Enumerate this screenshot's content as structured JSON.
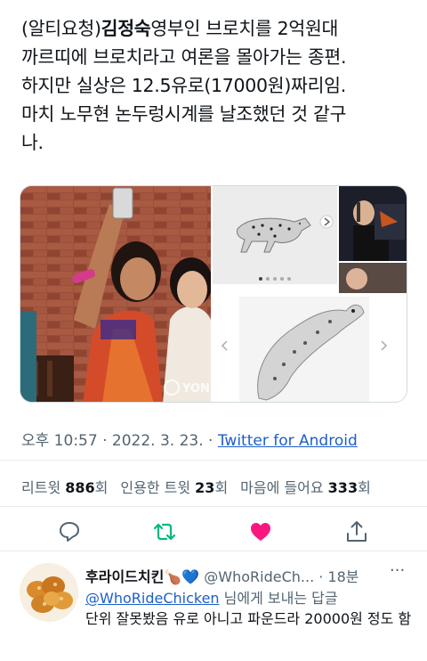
{
  "tweet": {
    "line1_pre": "(알티요청)",
    "line1_bold": "김정숙",
    "line1_post": "영부인 브로치를 2억원대",
    "line2": "까르띠에 브로치라고 여론을 몰아가는 종편.",
    "line3": "하지만 실상은 12.5유로(17000원)짜리임.",
    "line4": "마치 노무현 논두렁시계를 날조했던 것 같구",
    "line5": "나."
  },
  "media": {
    "watermark": "YON",
    "carousel_dots": 5,
    "carousel_active": 0
  },
  "meta": {
    "time": "오후 10:57",
    "sep1": " · ",
    "date": "2022. 3. 23.",
    "sep2": " · ",
    "source": "Twitter for Android"
  },
  "stats": {
    "retweets_label": "리트윗 ",
    "retweets": "886",
    "retweets_unit": "회",
    "quotes_label": "인용한 트윗 ",
    "quotes": "23",
    "quotes_unit": "회",
    "likes_label": "마음에 들어요 ",
    "likes": "333",
    "likes_unit": "회"
  },
  "actions": {
    "icons": [
      "reply-icon",
      "retweet-icon",
      "like-icon",
      "share-icon"
    ],
    "colors": {
      "retweet": "#00ba7c",
      "like": "#f91880",
      "default": "#536471"
    }
  },
  "reply": {
    "name": "후라이드치킨",
    "emoji": "🍗💙",
    "handle": "@WhoRideCh...",
    "time": " · 18분",
    "replying_to_mention": "@WhoRideChicken",
    "replying_to_suffix": " 님에게 보내는 답글",
    "text": "단위 잘못봤음 유로 아니고 파운드라 20000원 정도 함",
    "more": "···"
  }
}
